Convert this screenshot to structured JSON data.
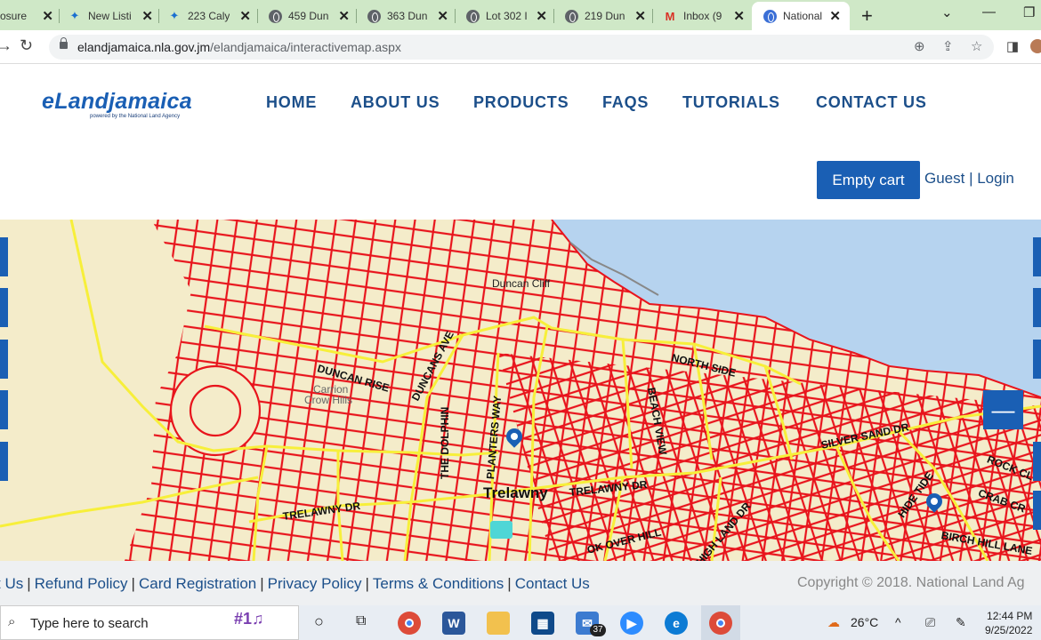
{
  "browser": {
    "tabs": [
      {
        "title": "osure",
        "icon": "generic-page-icon"
      },
      {
        "title": "New Listi",
        "icon": "butterfly-icon"
      },
      {
        "title": "223 Caly",
        "icon": "butterfly-icon"
      },
      {
        "title": "459 Dun",
        "icon": "globe-icon"
      },
      {
        "title": "363 Dun",
        "icon": "globe-icon"
      },
      {
        "title": "Lot 302 I",
        "icon": "globe-icon"
      },
      {
        "title": "219 Dun",
        "icon": "globe-icon"
      },
      {
        "title": "Inbox (9",
        "icon": "gmail-icon"
      },
      {
        "title": "National",
        "icon": "globe-icon",
        "active": true
      }
    ],
    "url_host": "elandjamaica.nla.gov.jm",
    "url_path": "/elandjamaica/interactivemap.aspx"
  },
  "site": {
    "logo": "eLandjamaica",
    "logo_tagline": "powered by the National Land Agency",
    "nav": [
      "HOME",
      "ABOUT US",
      "PRODUCTS",
      "FAQS",
      "TUTORIALS",
      "CONTACT US"
    ],
    "cart_label": "Empty cart",
    "auth": "Guest | Login",
    "accent": "#1a5fb4"
  },
  "map": {
    "labels": {
      "duncan_cliff": "Duncan Cliff",
      "north_side": "NORTH SIDE",
      "duncan_rise": "DUNCAN RISE",
      "duncans_ave": "DUNCANS AVE",
      "carrion": "Carrion",
      "crow_hills": "Crow Hills",
      "the_dolphin": "THE DOLPHIN",
      "planters_way": "PLANTERS WAY",
      "beach_view": "BEACH VIEW",
      "silver_sand": "SILVER SAND DR",
      "trelawny_dr_1": "TRELAWNY DR",
      "trelawny_dr_2": "TRELAWNY DR",
      "trelawny": "Trelawny",
      "ok_over_hill": "OK OVER HILL",
      "high_land": "HIGH LAND DR",
      "hide_tide": "HIDE TIDE",
      "rock_cl": "ROCK CL",
      "crab_cr": "CRAB CR",
      "birch_hill": "BIRCH HILL LANE"
    },
    "zoom_out_label": "—",
    "parcel_color": "#e8141c",
    "road_color": "#f7ef3a",
    "sea_color": "#b6d3ef",
    "land_color": "#f4ecca"
  },
  "footer": {
    "links": [
      "t Us",
      "Refund Policy",
      "Card Registration",
      "Privacy Policy",
      "Terms & Conditions",
      "Contact Us"
    ],
    "copyright": "Copyright © 2018. National Land Ag"
  },
  "taskbar": {
    "search_placeholder": "Type here to search",
    "mail_badge": "37",
    "weather": "26°C",
    "time": "12:44 PM",
    "date": "9/25/2022"
  }
}
